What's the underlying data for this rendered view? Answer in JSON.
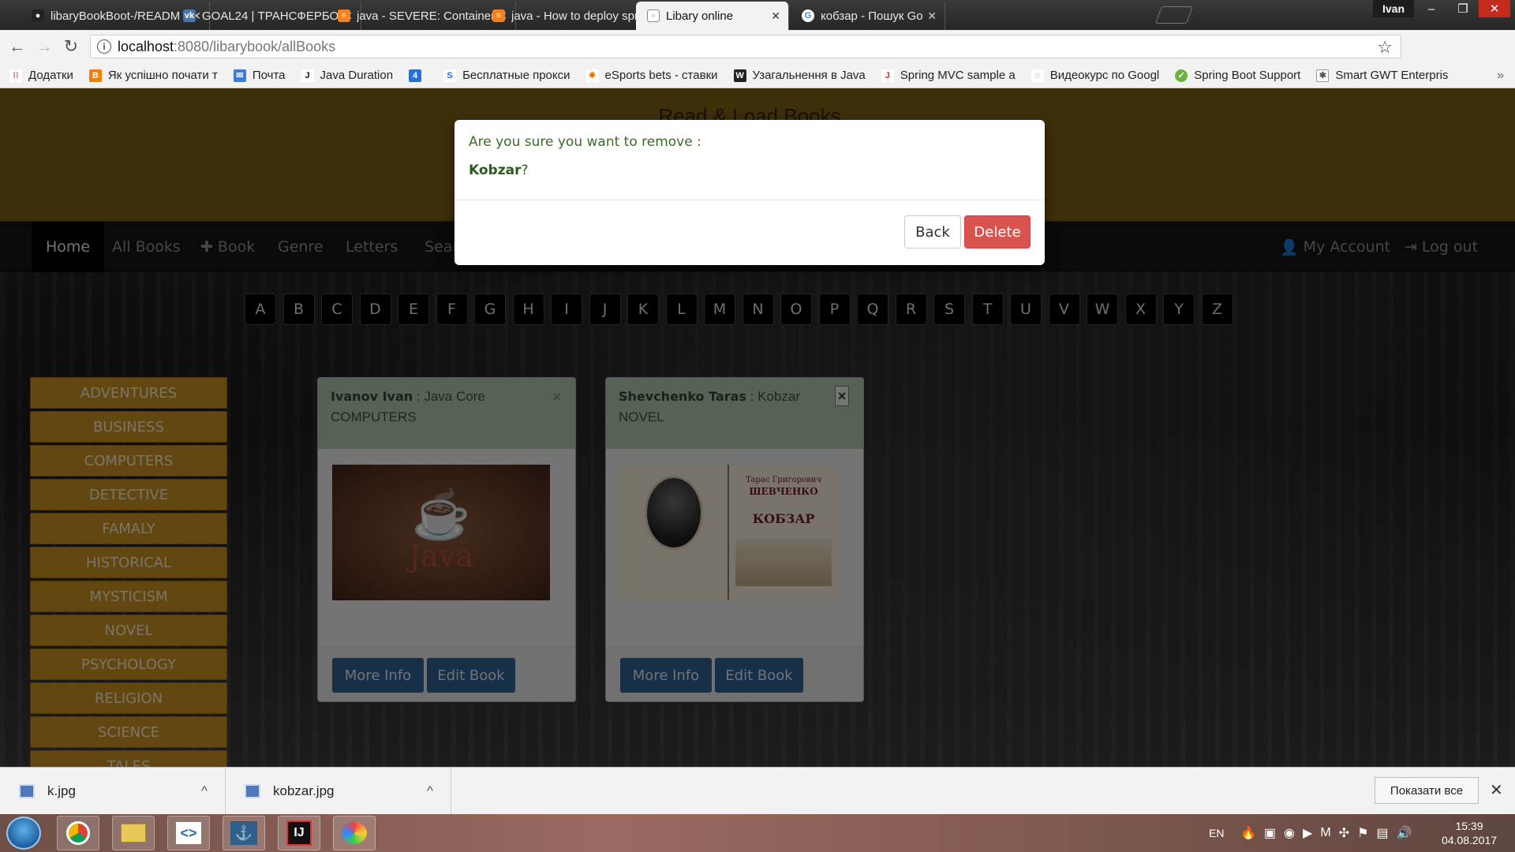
{
  "browser": {
    "tabs": [
      {
        "title": "libaryBookBoot-/READM",
        "favicon": "github-icon",
        "active": false
      },
      {
        "title": "GOAL24 | ТРАНСФЕРБО",
        "favicon": "vk-icon",
        "active": false
      },
      {
        "title": "java - SEVERE: Container",
        "favicon": "stackoverflow-icon",
        "active": false
      },
      {
        "title": "java - How to deploy spr",
        "favicon": "stackoverflow-icon",
        "active": false
      },
      {
        "title": "Libary online",
        "favicon": "page-icon",
        "active": true
      },
      {
        "title": "кобзар - Пошук Google",
        "favicon": "google-icon",
        "active": false
      }
    ],
    "profile_name": "Ivan",
    "url_host": "localhost",
    "url_path": ":8080/libarybook/allBooks",
    "bookmarks": [
      {
        "label": "Додатки",
        "icon": "apps-icon"
      },
      {
        "label": "Як успішно почати т",
        "icon": "blogger-icon"
      },
      {
        "label": "Почта",
        "icon": "mail-icon"
      },
      {
        "label": "Java Duration",
        "icon": "j-icon"
      },
      {
        "label": "",
        "icon": "four-icon"
      },
      {
        "label": "Бесплатные прокси",
        "icon": "s-icon"
      },
      {
        "label": "eSports bets - ставки",
        "icon": "esports-icon"
      },
      {
        "label": "Узагальнення в Java",
        "icon": "w-icon"
      },
      {
        "label": "Spring MVC sample a",
        "icon": "spring-mvc-icon"
      },
      {
        "label": "Видеокурс по Googl",
        "icon": "video-icon"
      },
      {
        "label": "Spring Boot Support",
        "icon": "spring-icon"
      },
      {
        "label": "Smart GWT Enterpris",
        "icon": "gwt-icon"
      }
    ]
  },
  "site": {
    "header_title": "Read & Load Books",
    "nav": [
      {
        "label": "Home",
        "icon": "",
        "active": true
      },
      {
        "label": "All Books",
        "icon": "",
        "active": false
      },
      {
        "label": "Book",
        "icon": "plus-icon",
        "active": false
      },
      {
        "label": "Genre",
        "icon": "",
        "active": false
      },
      {
        "label": "Letters",
        "icon": "",
        "active": false
      },
      {
        "label": "Sear",
        "icon": "",
        "active": false
      }
    ],
    "nav_right": [
      {
        "label": "My Account",
        "icon": "user-icon"
      },
      {
        "label": "Log out",
        "icon": "logout-icon"
      }
    ],
    "letters": [
      "A",
      "B",
      "C",
      "D",
      "E",
      "F",
      "G",
      "H",
      "I",
      "J",
      "K",
      "L",
      "M",
      "N",
      "O",
      "P",
      "Q",
      "R",
      "S",
      "T",
      "U",
      "V",
      "W",
      "X",
      "Y",
      "Z"
    ],
    "genres": [
      "ADVENTURES",
      "BUSINESS",
      "COMPUTERS",
      "DETECTIVE",
      "FAMALY",
      "HISTORICAL",
      "MYSTICISM",
      "NOVEL",
      "PSYCHOLOGY",
      "RELIGION",
      "SCIENCE",
      "TALES"
    ],
    "books": [
      {
        "author": "Ivanov Ivan",
        "separator": ":",
        "title": "Java Core",
        "genre": "COMPUTERS",
        "image": "java-cover",
        "more_label": "More Info",
        "edit_label": "Edit Book"
      },
      {
        "author": "Shevchenko Taras",
        "separator": ":",
        "title": "Kobzar",
        "genre": "NOVEL",
        "image": "kobzar-cover",
        "more_label": "More Info",
        "edit_label": "Edit Book",
        "cover_text": {
          "author_line": "Тарас Григорович",
          "surname": "ШЕВЧЕНКО",
          "title": "КОБЗАР"
        }
      }
    ],
    "card_close_glyph": "×"
  },
  "modal": {
    "question": "Are you sure you want to remove :",
    "book_name": "Kobzar",
    "suffix": "?",
    "back_label": "Back",
    "delete_label": "Delete",
    "colors": {
      "delete": "#d9534f",
      "text": "#3c6a2a"
    }
  },
  "downloads": {
    "items": [
      {
        "name": "k.jpg"
      },
      {
        "name": "kobzar.jpg"
      }
    ],
    "show_all_label": "Показати все"
  },
  "taskbar": {
    "apps": [
      "chrome-icon",
      "explorer-icon",
      "visual-studio-icon",
      "mysql-workbench-icon",
      "intellij-icon",
      "paint-icon"
    ],
    "language": "EN",
    "time": "15:39",
    "date": "04.08.2017"
  }
}
